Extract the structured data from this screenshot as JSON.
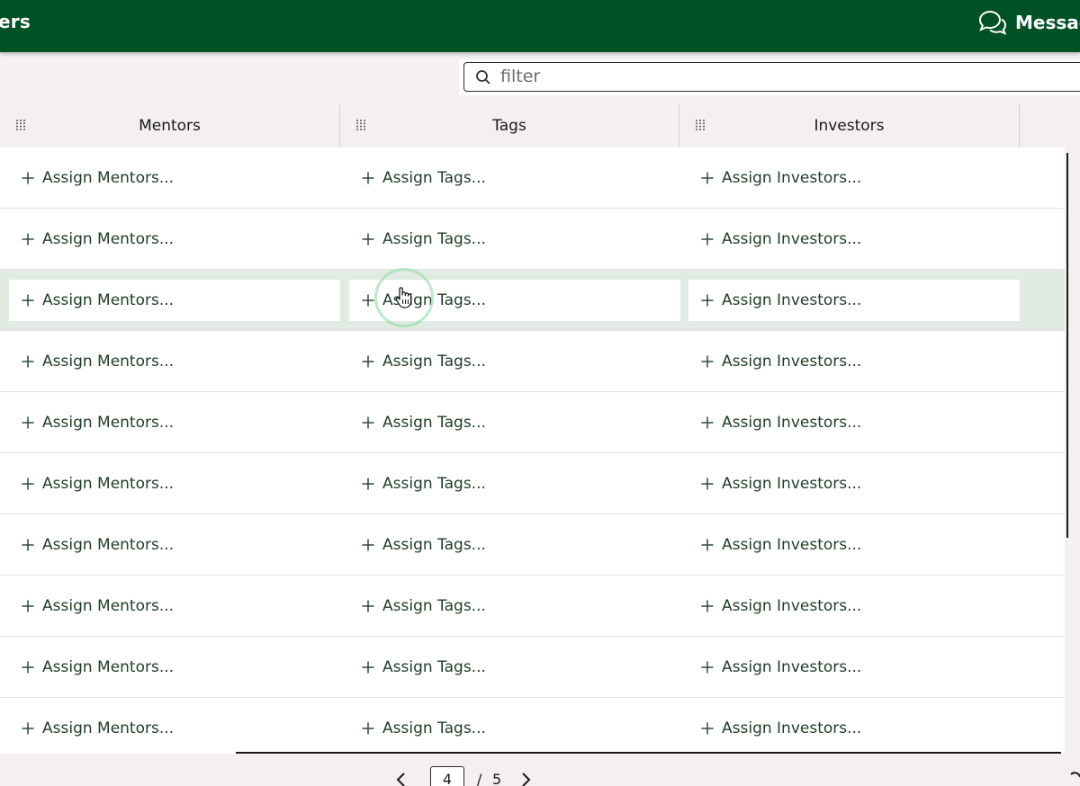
{
  "app": {
    "title_fragment": "ers",
    "messages_label": "Messag"
  },
  "filter": {
    "placeholder": "filter",
    "value": ""
  },
  "columns": [
    {
      "label": "Mentors"
    },
    {
      "label": "Tags"
    },
    {
      "label": "Investors"
    }
  ],
  "rows": [
    {
      "mentors": "Assign Mentors...",
      "tags": "Assign Tags...",
      "investors": "Assign Investors..."
    },
    {
      "mentors": "Assign Mentors...",
      "tags": "Assign Tags...",
      "investors": "Assign Investors..."
    },
    {
      "mentors": "Assign Mentors...",
      "tags": "Assign Tags...",
      "investors": "Assign Investors..."
    },
    {
      "mentors": "Assign Mentors...",
      "tags": "Assign Tags...",
      "investors": "Assign Investors..."
    },
    {
      "mentors": "Assign Mentors...",
      "tags": "Assign Tags...",
      "investors": "Assign Investors..."
    },
    {
      "mentors": "Assign Mentors...",
      "tags": "Assign Tags...",
      "investors": "Assign Investors..."
    },
    {
      "mentors": "Assign Mentors...",
      "tags": "Assign Tags...",
      "investors": "Assign Investors..."
    },
    {
      "mentors": "Assign Mentors...",
      "tags": "Assign Tags...",
      "investors": "Assign Investors..."
    },
    {
      "mentors": "Assign Mentors...",
      "tags": "Assign Tags...",
      "investors": "Assign Investors..."
    },
    {
      "mentors": "Assign Mentors...",
      "tags": "Assign Tags...",
      "investors": "Assign Investors..."
    }
  ],
  "hovered_row_index": 2,
  "pagination": {
    "current_page": "4",
    "separator": "/",
    "total_pages": "5"
  },
  "icons": {
    "messages": "chat-bubbles-icon",
    "filter": "search-icon",
    "column_grip": "drag-grip-icon",
    "assign": "plus-icon",
    "prev": "chevron-left-icon",
    "next": "chevron-right-icon"
  },
  "colors": {
    "brand_green": "#005224",
    "row_hover": "#e2ebe3",
    "header_bg": "#f4f0f2",
    "link_text": "#1f3d27"
  }
}
